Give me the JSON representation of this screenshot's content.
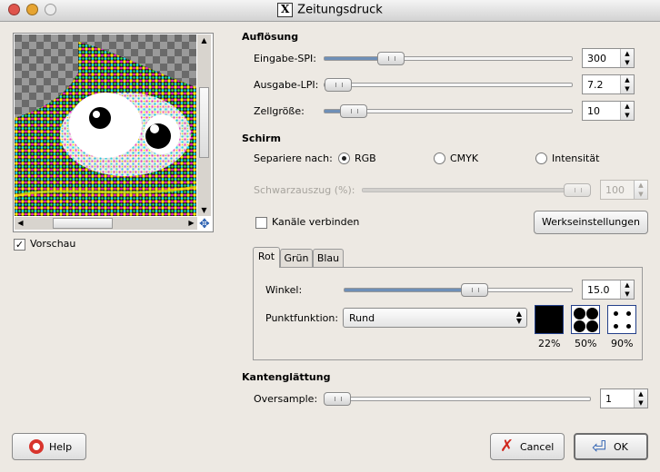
{
  "window": {
    "title": "Zeitungsdruck"
  },
  "preview": {
    "checkbox_label": "Vorschau",
    "checked": true
  },
  "resolution": {
    "heading": "Auflösung",
    "input_spi": {
      "label": "Eingabe-SPI:",
      "value": "300"
    },
    "output_lpi": {
      "label": "Ausgabe-LPI:",
      "value": "7.2"
    },
    "cell_size": {
      "label": "Zellgröße:",
      "value": "10"
    }
  },
  "screen": {
    "heading": "Schirm",
    "separate_label": "Separiere nach:",
    "options": [
      "RGB",
      "CMYK",
      "Intensität"
    ],
    "selected": "RGB",
    "black_pullout": {
      "label": "Schwarzauszug (%):",
      "value": "100"
    },
    "lock_channels_label": "Kanäle verbinden",
    "lock_channels_checked": false,
    "factory_defaults_label": "Werkseinstellungen"
  },
  "channel_tabs": {
    "tabs": [
      "Rot",
      "Grün",
      "Blau"
    ],
    "active": "Rot"
  },
  "angle": {
    "label": "Winkel:",
    "value": "15.0"
  },
  "spot_function": {
    "label": "Punktfunktion:",
    "value": "Rund",
    "previews": [
      "22%",
      "50%",
      "90%"
    ]
  },
  "antialiasing": {
    "heading": "Kantenglättung",
    "oversample": {
      "label": "Oversample:",
      "value": "1"
    }
  },
  "buttons": {
    "help": "Help",
    "cancel": "Cancel",
    "ok": "OK"
  },
  "colors": {
    "slider_fill": "#6e8fb7",
    "dot_frame": "#24408a",
    "window_bg": "#ede9e3"
  }
}
